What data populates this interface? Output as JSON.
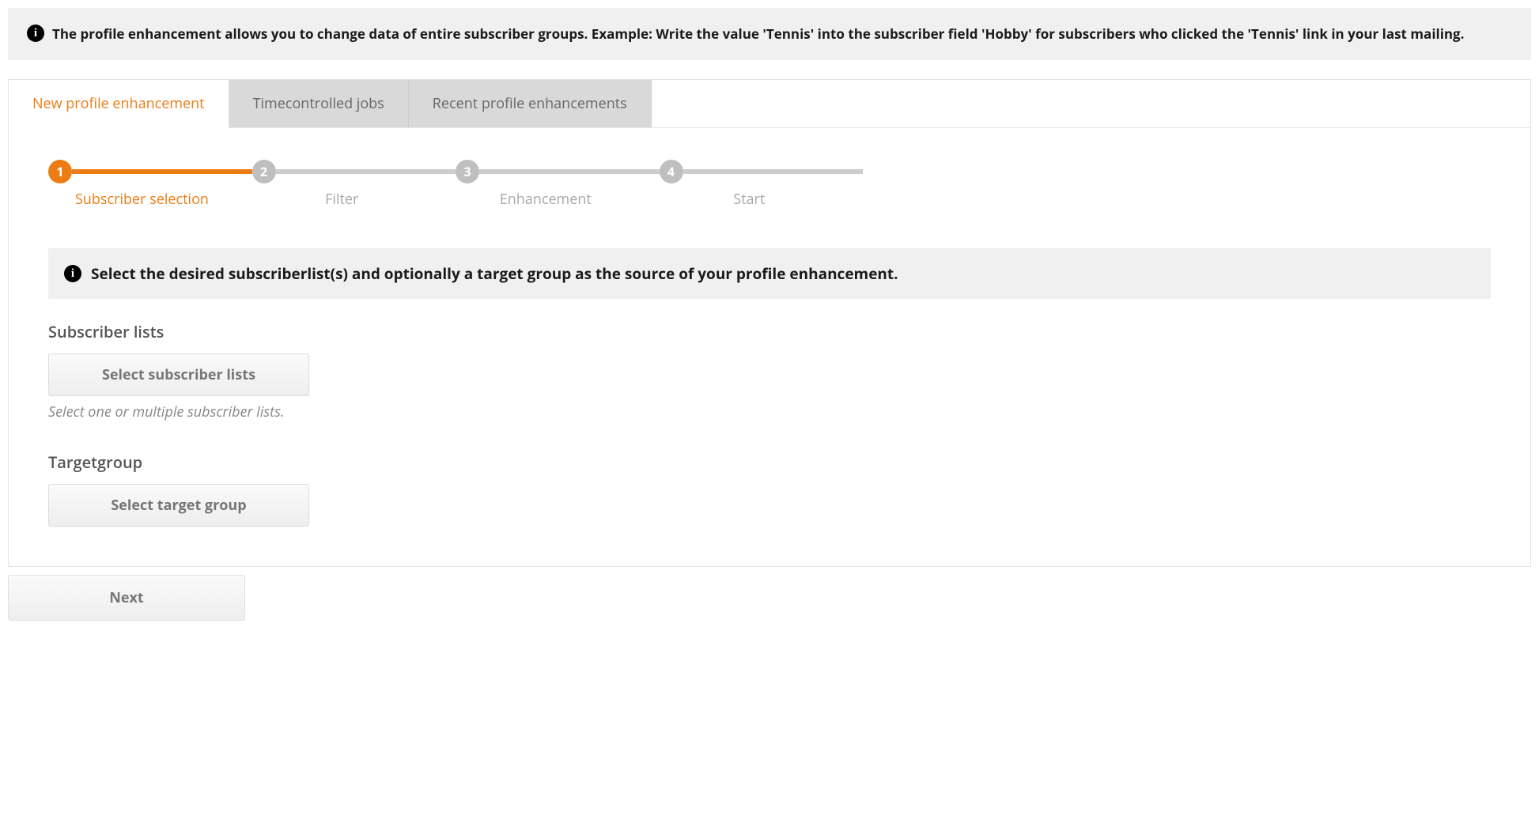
{
  "topInfo": "The profile enhancement allows you to change data of entire subscriber groups. Example: Write the value 'Tennis' into the subscriber field 'Hobby' for subscribers who clicked the 'Tennis' link in your last mailing.",
  "tabs": {
    "new": "New profile enhancement",
    "timecontrolled": "Timecontrolled jobs",
    "recent": "Recent profile enhancements"
  },
  "steps": {
    "s1": {
      "num": "1",
      "label": "Subscriber selection"
    },
    "s2": {
      "num": "2",
      "label": "Filter"
    },
    "s3": {
      "num": "3",
      "label": "Enhancement"
    },
    "s4": {
      "num": "4",
      "label": "Start"
    }
  },
  "innerInfo": "Select the desired subscriberlist(s) and optionally a target group as the source of your profile enhancement.",
  "subscriberLists": {
    "title": "Subscriber lists",
    "button": "Select subscriber lists",
    "hint": "Select one or multiple subscriber lists."
  },
  "targetGroup": {
    "title": "Targetgroup",
    "button": "Select target group"
  },
  "nextButton": "Next"
}
